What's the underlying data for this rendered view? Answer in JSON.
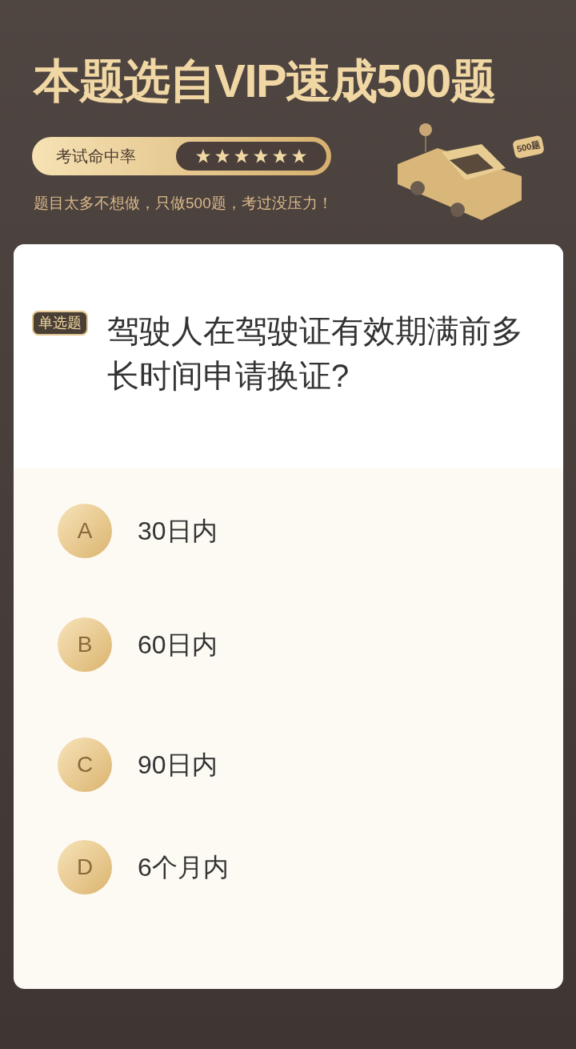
{
  "banner": {
    "title": "本题选自VIP速成500题",
    "rate_label": "考试命中率",
    "stars": 6,
    "subtitle": "题目太多不想做，只做500题，考过没压力！",
    "bubble": "500题"
  },
  "question": {
    "type_tag": "单选题",
    "text": "驾驶人在驾驶证有效期满前多长时间申请换证?"
  },
  "options": [
    {
      "letter": "A",
      "text": "30日内"
    },
    {
      "letter": "B",
      "text": "60日内"
    },
    {
      "letter": "C",
      "text": "90日内"
    },
    {
      "letter": "D",
      "text": "6个月内"
    }
  ]
}
